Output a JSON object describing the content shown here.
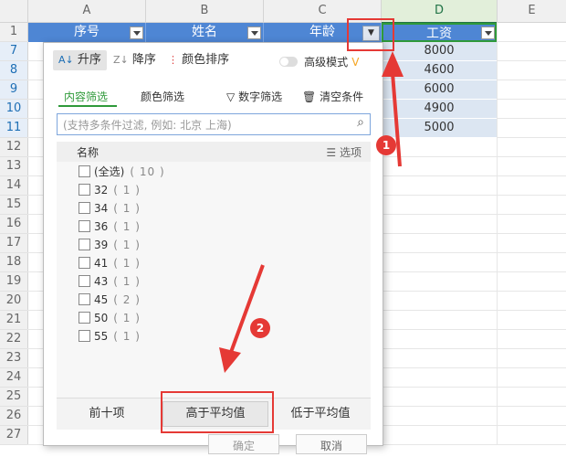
{
  "columns": [
    "A",
    "B",
    "C",
    "D",
    "E"
  ],
  "rows": [
    "1",
    "7",
    "8",
    "9",
    "10",
    "11",
    "12",
    "13",
    "14",
    "15",
    "16",
    "17",
    "18",
    "19",
    "20",
    "21",
    "22",
    "23",
    "24",
    "25",
    "26",
    "27"
  ],
  "header_cells": {
    "a": "序号",
    "b": "姓名",
    "c": "年龄",
    "d": "工资"
  },
  "salaries": [
    "8000",
    "4600",
    "6000",
    "4900",
    "5000"
  ],
  "panel": {
    "sort_asc": "升序",
    "sort_desc": "降序",
    "color_sort": "颜色排序",
    "advanced": "高级模式",
    "advanced_mark": "V",
    "tab_content": "内容筛选",
    "tab_color": "颜色筛选",
    "num_filter": "数字筛选",
    "clear": "清空条件",
    "search_placeholder": "(支持多条件过滤, 例如: 北京 上海)",
    "list_title": "名称",
    "options": "选项",
    "items": [
      {
        "label": "(全选)",
        "count": "( 10 )"
      },
      {
        "label": "32",
        "count": "( 1 )"
      },
      {
        "label": "34",
        "count": "( 1 )"
      },
      {
        "label": "36",
        "count": "( 1 )"
      },
      {
        "label": "39",
        "count": "( 1 )"
      },
      {
        "label": "41",
        "count": "( 1 )"
      },
      {
        "label": "43",
        "count": "( 1 )"
      },
      {
        "label": "45",
        "count": "( 2 )"
      },
      {
        "label": "50",
        "count": "( 1 )"
      },
      {
        "label": "55",
        "count": "( 1 )"
      }
    ],
    "top10": "前十项",
    "above_avg": "高于平均值",
    "below_avg": "低于平均值",
    "ok": "确定",
    "cancel": "取消"
  },
  "annotations": {
    "one": "1",
    "two": "2"
  },
  "colors": {
    "header_blue": "#4e86d4",
    "accent_green": "#2f9a3a",
    "annotation_red": "#e53935"
  }
}
